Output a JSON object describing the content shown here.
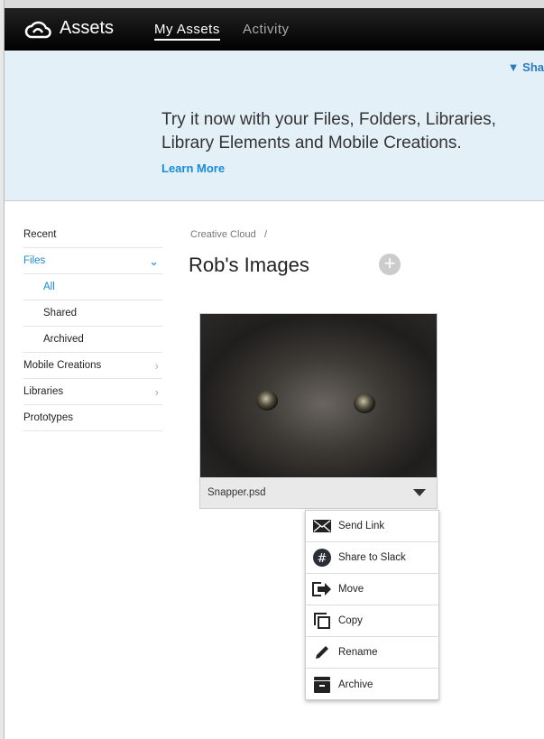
{
  "header": {
    "app_name": "Assets",
    "tabs": [
      {
        "label": "My Assets",
        "active": true
      },
      {
        "label": "Activity",
        "active": false
      }
    ]
  },
  "banner": {
    "share_label": "Sha",
    "promo_text": "Try it now with your Files, Folders, Libraries, Library Elements and Mobile Creations.",
    "learn_more": "Learn More",
    "background": "#e4f0f8"
  },
  "sidebar": {
    "items": [
      {
        "label": "Recent"
      },
      {
        "label": "Files"
      },
      {
        "label": "All"
      },
      {
        "label": "Shared"
      },
      {
        "label": "Archived"
      },
      {
        "label": "Mobile Creations"
      },
      {
        "label": "Libraries"
      },
      {
        "label": "Prototypes"
      }
    ]
  },
  "main": {
    "breadcrumb": "Creative Cloud",
    "breadcrumb_sep": "/",
    "title": "Rob's Images",
    "add_icon": "plus-circle-icon"
  },
  "file": {
    "name": "Snapper.psd"
  },
  "context_menu": {
    "items": [
      {
        "label": "Send Link",
        "icon": "envelope-icon"
      },
      {
        "label": "Share to Slack",
        "icon": "slack-icon"
      },
      {
        "label": "Move",
        "icon": "move-icon"
      },
      {
        "label": "Copy",
        "icon": "copy-icon"
      },
      {
        "label": "Rename",
        "icon": "pencil-icon"
      },
      {
        "label": "Archive",
        "icon": "archive-icon"
      }
    ]
  },
  "accent_color": "#1a8bd6"
}
